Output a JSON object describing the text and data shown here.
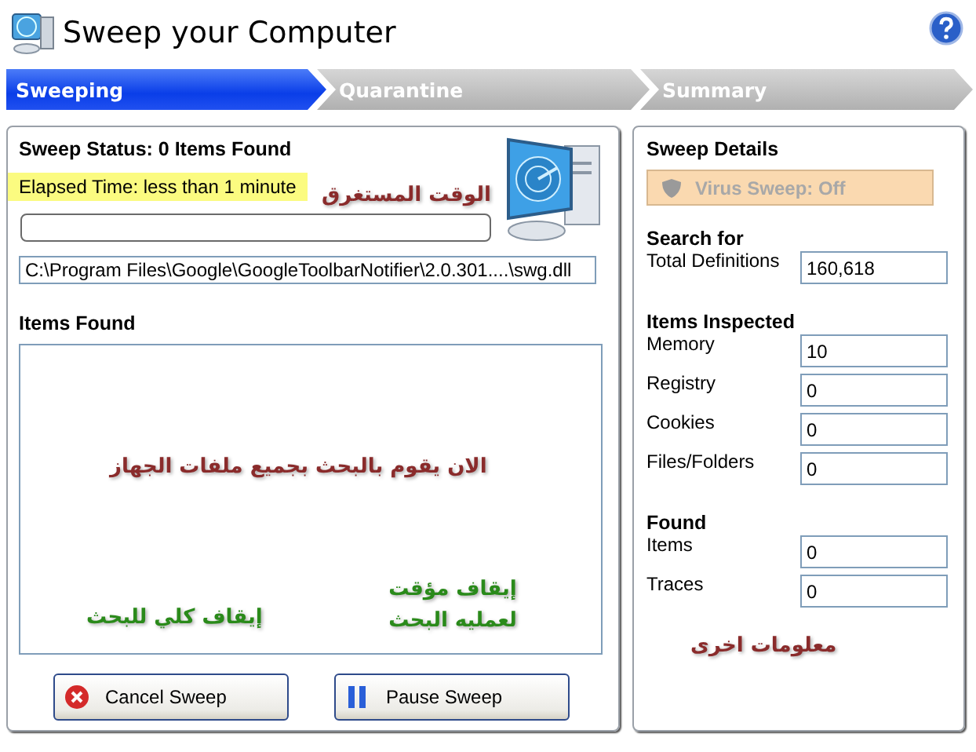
{
  "window": {
    "title": "Sweep your Computer"
  },
  "steps": [
    {
      "label": "Sweeping",
      "selected": true
    },
    {
      "label": "Quarantine",
      "selected": false
    },
    {
      "label": "Summary",
      "selected": false
    }
  ],
  "sweep": {
    "status": "Sweep Status: 0 Items Found",
    "elapsed": "Elapsed Time: less than 1 minute",
    "level": 0,
    "current_file": "C:\\Program Files\\Google\\GoogleToolbarNotifier\\2.0.301....\\swg.dll",
    "items_found_label": "Items Found"
  },
  "buttons": [
    {
      "kind": "cancel",
      "label": "Cancel Sweep"
    },
    {
      "kind": "pause",
      "label": "Pause Sweep"
    }
  ],
  "details": {
    "title": "Sweep Details",
    "virus_sweep": {
      "label": "Virus Sweep: Off",
      "disabled": true
    },
    "groups": [
      {
        "title": "Search for",
        "rows": [
          {
            "label": "Total Definitions",
            "value": "160,618"
          }
        ]
      },
      {
        "title": "Items Inspected",
        "rows": [
          {
            "label": "Memory",
            "value": "10"
          },
          {
            "label": "Registry",
            "value": "0"
          },
          {
            "label": "Cookies",
            "value": "0"
          },
          {
            "label": "Files/Folders",
            "value": "0"
          }
        ]
      },
      {
        "title": "Found",
        "rows": [
          {
            "label": "Items",
            "value": "0"
          },
          {
            "label": "Traces",
            "value": "0"
          }
        ]
      }
    ]
  },
  "annotations": [
    {
      "text": "الوقت المستغرق",
      "color": "#8a2b2b"
    },
    {
      "text": "الان يقوم بالبحث بجميع ملفات الجهاز",
      "color": "#8a2b2b"
    },
    {
      "text": "إيقاف مؤقت لعمليه البحث",
      "color": "#2a8a1a"
    },
    {
      "text": "إيقاف كلي للبحث",
      "color": "#2a8a1a"
    },
    {
      "text": "معلومات اخرى",
      "color": "#8a2b2b"
    }
  ]
}
